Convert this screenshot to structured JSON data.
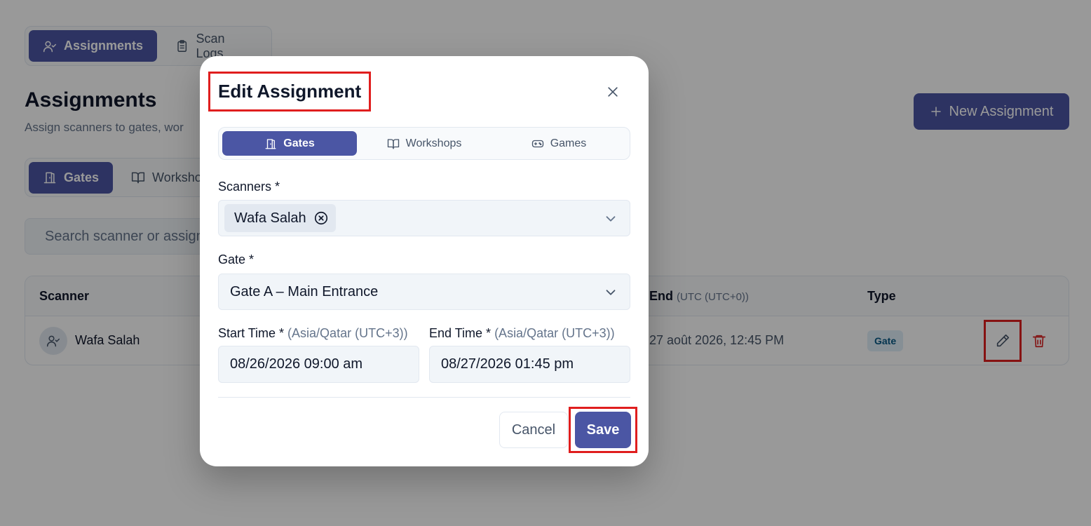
{
  "top_tabs": [
    {
      "label": "Assignments",
      "active": true
    },
    {
      "label": "Scan Logs",
      "active": false
    }
  ],
  "header": {
    "title": "Assignments",
    "subtitle": "Assign scanners to gates, wor",
    "new_button_label": "New Assignment"
  },
  "sub_tabs": [
    {
      "label": "Gates",
      "active": true
    },
    {
      "label": "Workshops",
      "active": false
    }
  ],
  "search": {
    "placeholder": "Search scanner or assignment"
  },
  "table": {
    "columns": {
      "scanner": "Scanner",
      "end": "End",
      "end_note": "(UTC (UTC+0))",
      "type": "Type"
    },
    "rows": [
      {
        "scanner": "Wafa Salah",
        "end": "27 août 2026, 12:45 PM",
        "type": "Gate"
      }
    ]
  },
  "modal": {
    "title": "Edit Assignment",
    "tabs": [
      {
        "label": "Gates",
        "active": true
      },
      {
        "label": "Workshops",
        "active": false
      },
      {
        "label": "Games",
        "active": false
      }
    ],
    "scanners_label": "Scanners *",
    "selected_scanner": "Wafa Salah",
    "gate_label": "Gate *",
    "gate_value": "Gate A – Main Entrance",
    "start_label": "Start Time *",
    "start_tz": "(Asia/Qatar (UTC+3))",
    "start_value": "08/26/2026 09:00 am",
    "end_label": "End Time *",
    "end_tz": "(Asia/Qatar (UTC+3))",
    "end_value": "08/27/2026 01:45 pm",
    "cancel_label": "Cancel",
    "save_label": "Save"
  },
  "colors": {
    "primary": "#4b56a4",
    "highlight": "#e01e1e",
    "badge_bg": "#e0eef8",
    "badge_text": "#075985",
    "danger": "#dc2626"
  }
}
